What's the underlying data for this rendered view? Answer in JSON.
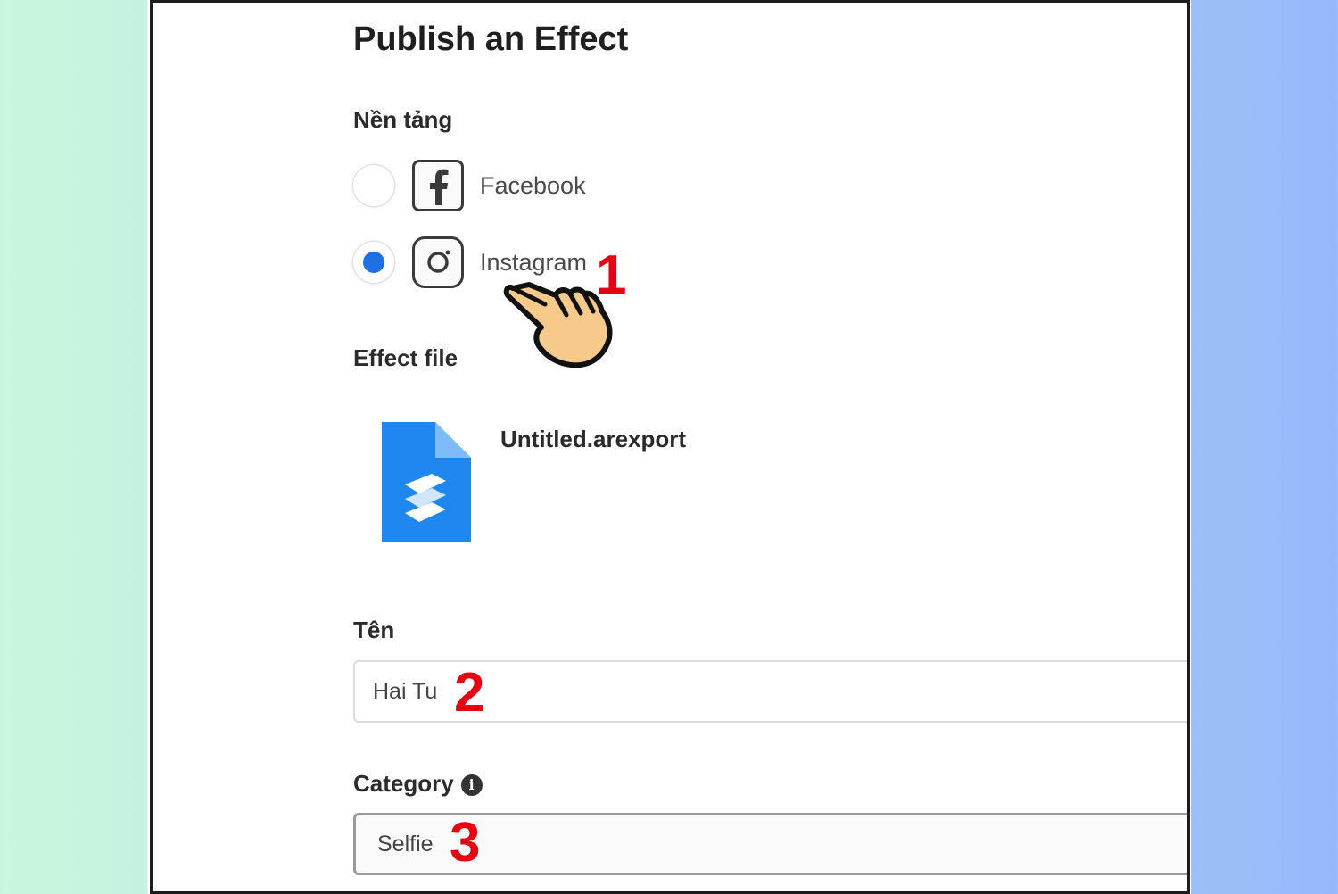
{
  "page": {
    "title": "Publish an Effect"
  },
  "platform": {
    "label": "Nền tảng",
    "options": [
      {
        "label": "Facebook",
        "selected": false,
        "icon": "facebook-icon"
      },
      {
        "label": "Instagram",
        "selected": true,
        "icon": "instagram-icon"
      }
    ]
  },
  "effect_file": {
    "label": "Effect file",
    "file_name": "Untitled.arexport",
    "icon": "spark-ar-file-icon"
  },
  "name_field": {
    "label": "Tên",
    "value": "Hai Tu"
  },
  "category_field": {
    "label": "Category",
    "info_icon": "i",
    "value": "Selfie"
  },
  "annotations": {
    "step1": "1",
    "step2": "2",
    "step3": "3"
  },
  "colors": {
    "radio_selected": "#1f6fe5",
    "step_number": "#e60012",
    "file_icon": "#1e88f0"
  }
}
